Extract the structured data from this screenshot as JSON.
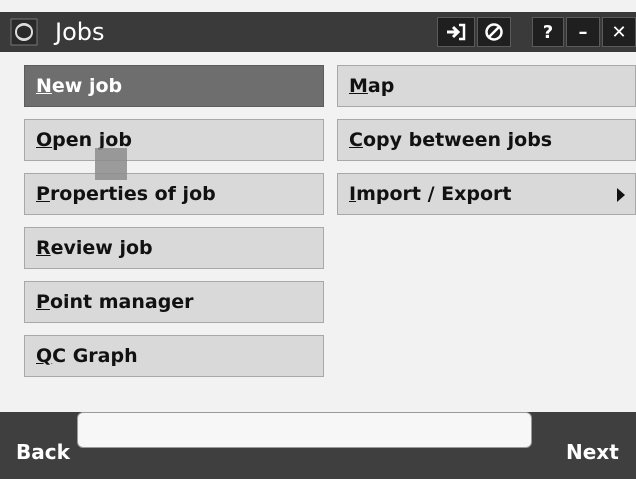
{
  "titlebar": {
    "title": "Jobs",
    "icons": [
      "trimble-logo-icon",
      "login-arrow-icon",
      "no-entry-icon",
      "help-icon",
      "minimize-icon",
      "close-icon"
    ],
    "help_label": "?",
    "minimize_label": "–",
    "close_label": "✕"
  },
  "menu": {
    "left": [
      {
        "mnemonic": "N",
        "rest": "ew job",
        "selected": true
      },
      {
        "mnemonic": "O",
        "rest": "pen job"
      },
      {
        "mnemonic": "P",
        "rest": "roperties of job"
      },
      {
        "mnemonic": "R",
        "rest": "eview job"
      },
      {
        "mnemonic": "P",
        "rest": "oint manager"
      },
      {
        "mnemonic": "Q",
        "rest": "C Graph"
      }
    ],
    "right": [
      {
        "mnemonic": "M",
        "rest": "ap"
      },
      {
        "mnemonic": "C",
        "rest": "opy between jobs"
      },
      {
        "mnemonic": "I",
        "rest": "mport / Export",
        "has_submenu": true
      }
    ]
  },
  "footer": {
    "back_label": "Back",
    "next_label": "Next",
    "status_text": ""
  },
  "colors": {
    "titlebar_bg": "#3a3a3a",
    "selected_button": "#6e6e6e",
    "button_bg": "#d9d9d9",
    "footer_bg": "#3f3f3f"
  }
}
